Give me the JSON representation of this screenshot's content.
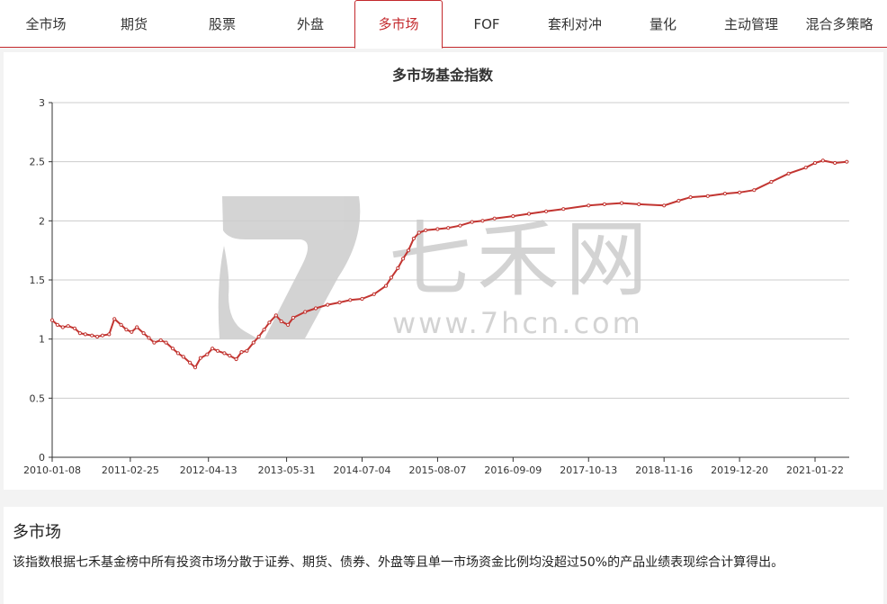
{
  "tabs": [
    {
      "label": "全市场",
      "active": false
    },
    {
      "label": "期货",
      "active": false
    },
    {
      "label": "股票",
      "active": false
    },
    {
      "label": "外盘",
      "active": false
    },
    {
      "label": "多市场",
      "active": true
    },
    {
      "label": "FOF",
      "active": false
    },
    {
      "label": "套利对冲",
      "active": false
    },
    {
      "label": "量化",
      "active": false
    },
    {
      "label": "主动管理",
      "active": false
    },
    {
      "label": "混合多策略",
      "active": false
    }
  ],
  "watermark": {
    "brand": "七禾网",
    "url": "www.7hcn.com"
  },
  "chart_data": {
    "type": "line",
    "title": "多市场基金指数",
    "xlabel": "",
    "ylabel": "",
    "ylim": [
      0,
      3
    ],
    "yticks": [
      "0",
      "0.5",
      "1",
      "1.5",
      "2",
      "2.5",
      "3"
    ],
    "xticks": [
      "2010-01-08",
      "2011-02-25",
      "2012-04-13",
      "2013-05-31",
      "2014-07-04",
      "2015-08-07",
      "2016-09-09",
      "2017-10-13",
      "2018-11-16",
      "2019-12-20",
      "2021-01-22"
    ],
    "grid": true,
    "color": "#c23531",
    "series": [
      {
        "name": "",
        "points": [
          [
            "2010-01-08",
            1.16
          ],
          [
            "2010-02-05",
            1.12
          ],
          [
            "2010-03-05",
            1.1
          ],
          [
            "2010-04-02",
            1.11
          ],
          [
            "2010-05-07",
            1.09
          ],
          [
            "2010-06-04",
            1.05
          ],
          [
            "2010-07-02",
            1.04
          ],
          [
            "2010-08-06",
            1.03
          ],
          [
            "2010-09-03",
            1.02
          ],
          [
            "2010-10-01",
            1.03
          ],
          [
            "2010-11-05",
            1.04
          ],
          [
            "2010-12-03",
            1.17
          ],
          [
            "2011-01-07",
            1.12
          ],
          [
            "2011-02-04",
            1.08
          ],
          [
            "2011-03-04",
            1.06
          ],
          [
            "2011-04-01",
            1.1
          ],
          [
            "2011-05-06",
            1.05
          ],
          [
            "2011-06-03",
            1.01
          ],
          [
            "2011-07-01",
            0.97
          ],
          [
            "2011-08-05",
            0.99
          ],
          [
            "2011-09-02",
            0.97
          ],
          [
            "2011-10-07",
            0.92
          ],
          [
            "2011-11-04",
            0.88
          ],
          [
            "2011-12-02",
            0.85
          ],
          [
            "2012-01-06",
            0.8
          ],
          [
            "2012-02-03",
            0.76
          ],
          [
            "2012-03-02",
            0.84
          ],
          [
            "2012-04-06",
            0.87
          ],
          [
            "2012-05-04",
            0.92
          ],
          [
            "2012-06-01",
            0.9
          ],
          [
            "2012-07-06",
            0.88
          ],
          [
            "2012-08-03",
            0.86
          ],
          [
            "2012-09-07",
            0.83
          ],
          [
            "2012-10-05",
            0.89
          ],
          [
            "2012-11-02",
            0.9
          ],
          [
            "2012-12-07",
            0.97
          ],
          [
            "2013-01-04",
            1.02
          ],
          [
            "2013-02-01",
            1.08
          ],
          [
            "2013-03-01",
            1.14
          ],
          [
            "2013-04-05",
            1.2
          ],
          [
            "2013-05-03",
            1.15
          ],
          [
            "2013-06-07",
            1.12
          ],
          [
            "2013-07-05",
            1.18
          ],
          [
            "2013-09-06",
            1.23
          ],
          [
            "2013-11-01",
            1.26
          ],
          [
            "2014-01-03",
            1.29
          ],
          [
            "2014-03-07",
            1.31
          ],
          [
            "2014-05-02",
            1.33
          ],
          [
            "2014-07-04",
            1.34
          ],
          [
            "2014-09-05",
            1.38
          ],
          [
            "2014-11-07",
            1.45
          ],
          [
            "2014-12-05",
            1.52
          ],
          [
            "2015-01-09",
            1.6
          ],
          [
            "2015-02-06",
            1.68
          ],
          [
            "2015-03-06",
            1.75
          ],
          [
            "2015-04-03",
            1.85
          ],
          [
            "2015-05-01",
            1.9
          ],
          [
            "2015-06-05",
            1.92
          ],
          [
            "2015-08-07",
            1.93
          ],
          [
            "2015-10-02",
            1.94
          ],
          [
            "2015-12-04",
            1.96
          ],
          [
            "2016-02-05",
            1.99
          ],
          [
            "2016-04-01",
            2.0
          ],
          [
            "2016-06-03",
            2.02
          ],
          [
            "2016-09-09",
            2.04
          ],
          [
            "2016-12-02",
            2.06
          ],
          [
            "2017-03-03",
            2.08
          ],
          [
            "2017-06-02",
            2.1
          ],
          [
            "2017-10-13",
            2.13
          ],
          [
            "2018-01-05",
            2.14
          ],
          [
            "2018-04-06",
            2.15
          ],
          [
            "2018-07-06",
            2.14
          ],
          [
            "2018-11-16",
            2.13
          ],
          [
            "2019-02-01",
            2.17
          ],
          [
            "2019-04-05",
            2.2
          ],
          [
            "2019-07-05",
            2.21
          ],
          [
            "2019-10-04",
            2.23
          ],
          [
            "2019-12-20",
            2.24
          ],
          [
            "2020-03-06",
            2.26
          ],
          [
            "2020-06-05",
            2.33
          ],
          [
            "2020-09-04",
            2.4
          ],
          [
            "2020-12-04",
            2.45
          ],
          [
            "2021-01-22",
            2.49
          ],
          [
            "2021-03-05",
            2.51
          ],
          [
            "2021-05-07",
            2.49
          ],
          [
            "2021-07-09",
            2.5
          ]
        ]
      }
    ]
  },
  "description": {
    "title": "多市场",
    "text": "该指数根据七禾基金榜中所有投资市场分散于证券、期货、债券、外盘等且单一市场资金比例均没超过50%的产品业绩表现综合计算得出。"
  }
}
